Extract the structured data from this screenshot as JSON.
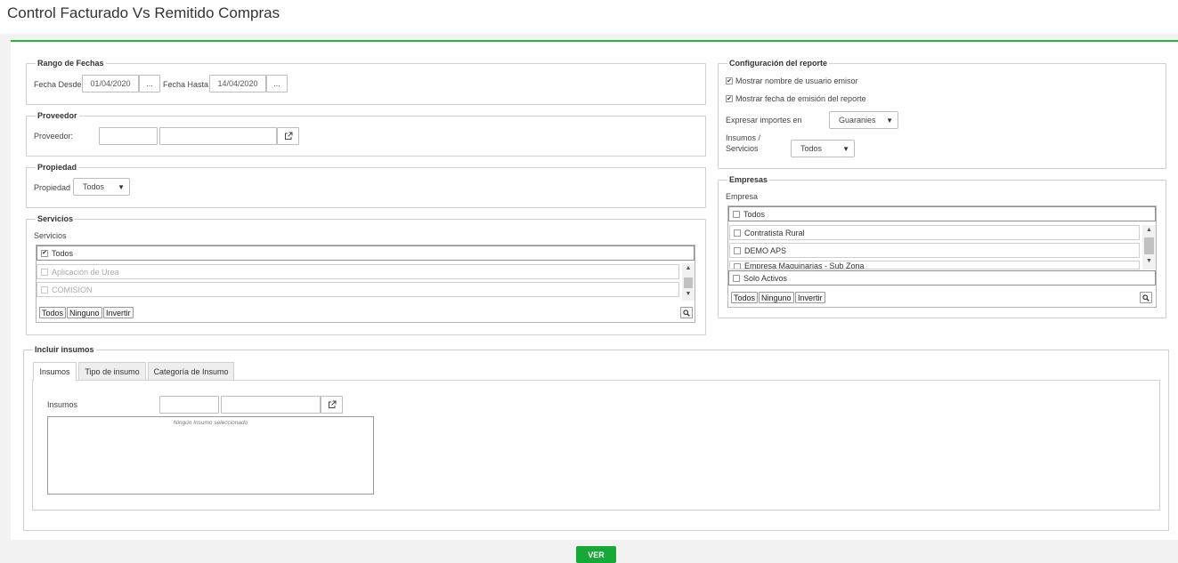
{
  "title": "Control Facturado Vs Remitido Compras",
  "fechas": {
    "legend": "Rango de Fechas",
    "desde_label": "Fecha Desde",
    "desde_value": "01/04/2020",
    "hasta_label": "Fecha Hasta",
    "hasta_value": "14/04/2020",
    "picker_label": "..."
  },
  "proveedor": {
    "legend": "Proveedor",
    "label": "Proveedor:"
  },
  "propiedad": {
    "legend": "Propiedad",
    "label": "Propiedad",
    "selected": "Todos"
  },
  "servicios": {
    "legend": "Servicios",
    "label": "Servicios",
    "all_label": "Todos",
    "all_checked": true,
    "items": [
      {
        "label": "Aplicación de Urea"
      },
      {
        "label": "COMISION"
      }
    ],
    "buttons": {
      "all": "Todos",
      "none": "Ninguno",
      "invert": "Invertir"
    }
  },
  "config": {
    "legend": "Configuración del reporte",
    "show_user": "Mostrar nombre de usuario emisor",
    "show_user_checked": true,
    "show_date": "Mostrar fecha de emisión del reporte",
    "show_date_checked": true,
    "importes_label": "Expresar importes en",
    "importes_selected": "Guaranies",
    "insumos_label_1": "Insumos /",
    "insumos_label_2": "Servicios",
    "insumos_selected": "Todos"
  },
  "empresas": {
    "legend": "Empresas",
    "label": "Empresa",
    "all_label": "Todos",
    "items": [
      {
        "label": "Contratista Rural"
      },
      {
        "label": "DEMO APS"
      },
      {
        "label": "Empresa Maquinarias - Sub Zona"
      }
    ],
    "solo_activos": "Solo Activos",
    "buttons": {
      "all": "Todos",
      "none": "Ninguno",
      "invert": "Invertir"
    }
  },
  "insumos": {
    "legend": "Incluir insumos",
    "tabs": [
      {
        "label": "Insumos",
        "active": true
      },
      {
        "label": "Tipo de insumo",
        "active": false
      },
      {
        "label": "Categoría de Insumo",
        "active": false
      }
    ],
    "label": "Insumos",
    "empty_text": "Ningún Insumo seleccionado"
  },
  "ver_label": "VER",
  "colors": {
    "accent": "#22bb33",
    "button": "#17a937"
  },
  "icons": {
    "external": "external-link-icon",
    "search": "search-icon",
    "dropdown": "caret-down-icon"
  }
}
